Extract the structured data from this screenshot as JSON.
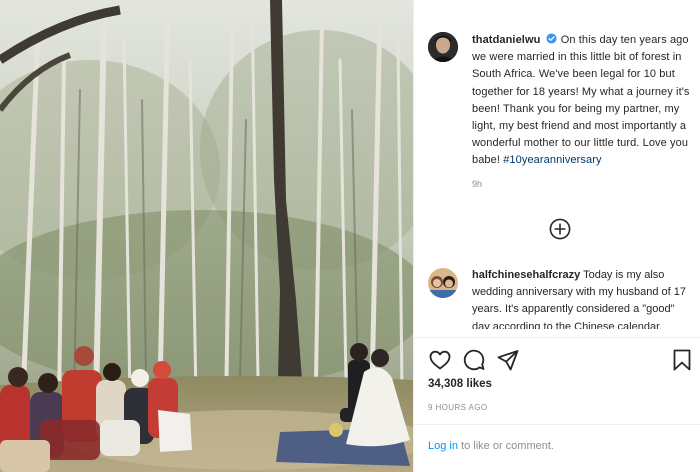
{
  "post": {
    "username": "thatdanielwu",
    "caption": "On this day ten years ago we were married in this little bit of forest in South Africa. We've been legal for 10 but together for 18 years! My what a journey it's been! Thank you for being my partner, my light, my best friend and most importantly a wonderful mother to our little turd. Love you babe!",
    "hashtag": "#10yearanniversary",
    "caption_time": "9h",
    "likes": "34,308 likes",
    "posted_ago": "9 HOURS AGO"
  },
  "comment": {
    "username": "halfchinesehalfcrazy",
    "text": "Today is my also wedding anniversary with my husband of 17 years. It's apparently considered a \"good\" day according to the Chinese calendar."
  },
  "login": {
    "link": "Log in",
    "suffix": "to like or comment."
  },
  "icons": {
    "verified": "verified-badge-icon",
    "load_more": "plus-circle-icon",
    "like": "heart-icon",
    "comment": "comment-bubble-icon",
    "share": "paper-plane-icon",
    "save": "bookmark-icon"
  },
  "colors": {
    "verified": "#3897f0",
    "link": "#0095f6",
    "hashtag": "#00376b",
    "muted": "#8e8e8e"
  }
}
